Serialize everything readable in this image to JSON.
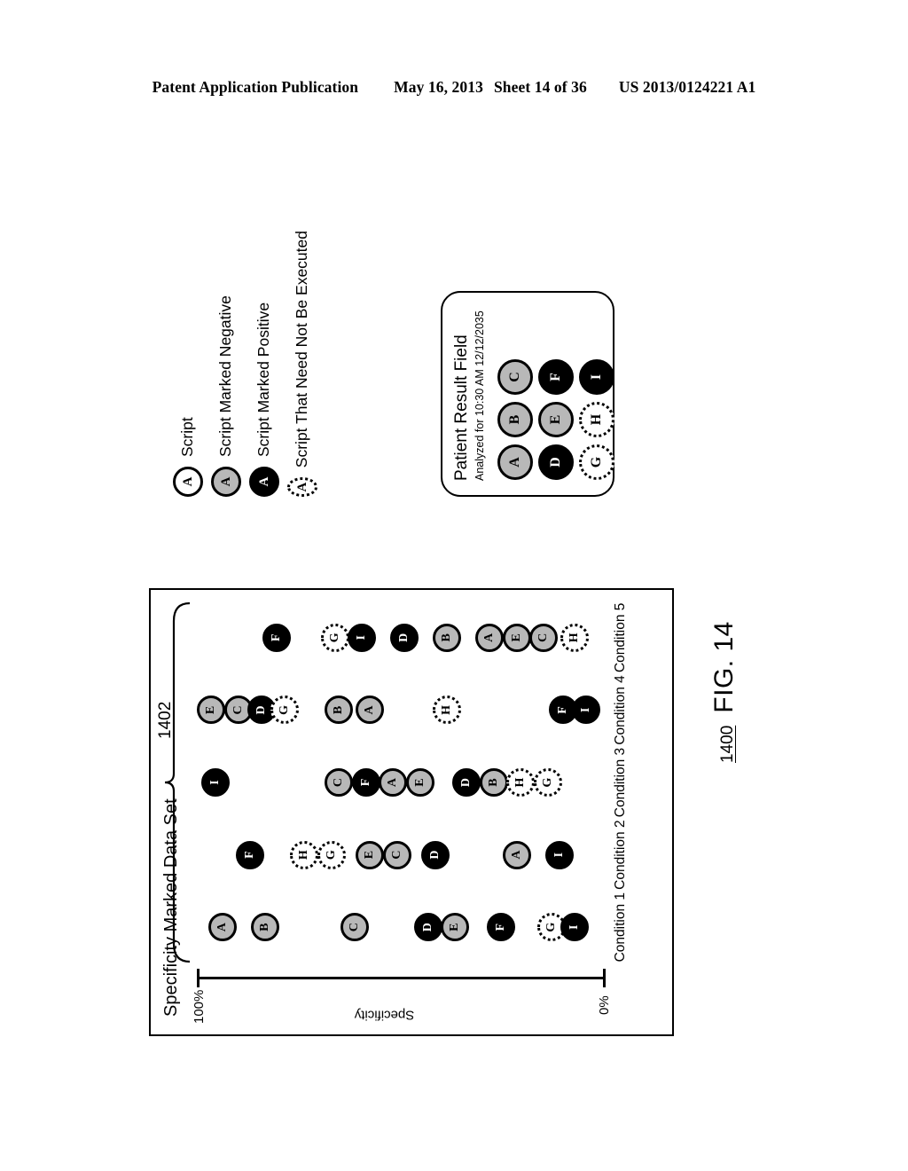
{
  "patent_header": {
    "publication": "Patent Application Publication",
    "date": "May 16, 2013",
    "sheet": "Sheet 14 of 36",
    "number": "US 2013/0124221 A1"
  },
  "legend": {
    "items": [
      {
        "marker": "A",
        "style": "plain",
        "label": "Script"
      },
      {
        "marker": "A",
        "style": "gray",
        "label": "Script Marked Negative"
      },
      {
        "marker": "A",
        "style": "black",
        "label": "Script Marked Positive"
      },
      {
        "marker": "A",
        "style": "dashed",
        "label": "Script That Need Not Be Executed"
      }
    ]
  },
  "patient_result_field": {
    "title": "Patient Result Field",
    "subtitle": "Analyzed for 10:30 AM 12/12/2035",
    "grid": [
      {
        "marker": "A",
        "style": "gray"
      },
      {
        "marker": "B",
        "style": "gray"
      },
      {
        "marker": "C",
        "style": "gray"
      },
      {
        "marker": "D",
        "style": "black"
      },
      {
        "marker": "E",
        "style": "gray"
      },
      {
        "marker": "F",
        "style": "black"
      },
      {
        "marker": "G",
        "style": "dashed"
      },
      {
        "marker": "H",
        "style": "dashed"
      },
      {
        "marker": "I",
        "style": "black"
      }
    ]
  },
  "figure": {
    "label": "FIG. 14",
    "number": "1400",
    "callout": "1402"
  },
  "chart_data": {
    "type": "scatter",
    "title": "Specificity Marked Data Set",
    "xlabel": "",
    "ylabel": "Specificity",
    "ylim": [
      0,
      100
    ],
    "ytick_labels": [
      "100%",
      "0%"
    ],
    "grid": false,
    "legend_position": "external-top-left",
    "categories": [
      "Condition 1",
      "Condition 2",
      "Condition 3",
      "Condition 4",
      "Condition 5"
    ],
    "callout_label": "1402",
    "callout_note": "Bracket spanning all conditions",
    "series": [
      {
        "name": "Condition 1",
        "points": [
          {
            "marker": "A",
            "style": "gray",
            "specificity": 96
          },
          {
            "marker": "B",
            "style": "gray",
            "specificity": 85
          },
          {
            "marker": "C",
            "style": "gray",
            "specificity": 62
          },
          {
            "marker": "D",
            "style": "black",
            "specificity": 43
          },
          {
            "marker": "E",
            "style": "gray",
            "specificity": 36
          },
          {
            "marker": "F",
            "style": "black",
            "specificity": 24
          },
          {
            "marker": "G",
            "style": "dashed",
            "specificity": 11
          },
          {
            "marker": "I",
            "style": "black",
            "specificity": 5
          }
        ]
      },
      {
        "name": "Condition 2",
        "points": [
          {
            "marker": "F",
            "style": "black",
            "specificity": 89
          },
          {
            "marker": "H",
            "style": "dashed",
            "specificity": 75
          },
          {
            "marker": "G",
            "style": "dashed",
            "specificity": 68
          },
          {
            "marker": "E",
            "style": "gray",
            "specificity": 58
          },
          {
            "marker": "C",
            "style": "gray",
            "specificity": 51
          },
          {
            "marker": "D",
            "style": "black",
            "specificity": 41
          },
          {
            "marker": "A",
            "style": "gray",
            "specificity": 20
          },
          {
            "marker": "I",
            "style": "black",
            "specificity": 9
          }
        ]
      },
      {
        "name": "Condition 3",
        "points": [
          {
            "marker": "I",
            "style": "black",
            "specificity": 98
          },
          {
            "marker": "C",
            "style": "gray",
            "specificity": 66
          },
          {
            "marker": "F",
            "style": "black",
            "specificity": 59
          },
          {
            "marker": "A",
            "style": "gray",
            "specificity": 52
          },
          {
            "marker": "E",
            "style": "gray",
            "specificity": 45
          },
          {
            "marker": "D",
            "style": "black",
            "specificity": 33
          },
          {
            "marker": "B",
            "style": "gray",
            "specificity": 26
          },
          {
            "marker": "H",
            "style": "dashed",
            "specificity": 19
          },
          {
            "marker": "G",
            "style": "dashed",
            "specificity": 12
          }
        ]
      },
      {
        "name": "Condition 4",
        "points": [
          {
            "marker": "E",
            "style": "gray",
            "specificity": 99
          },
          {
            "marker": "C",
            "style": "gray",
            "specificity": 92
          },
          {
            "marker": "D",
            "style": "black",
            "specificity": 86
          },
          {
            "marker": "G",
            "style": "dashed",
            "specificity": 80
          },
          {
            "marker": "B",
            "style": "gray",
            "specificity": 66
          },
          {
            "marker": "A",
            "style": "gray",
            "specificity": 58
          },
          {
            "marker": "H",
            "style": "dashed",
            "specificity": 38
          },
          {
            "marker": "F",
            "style": "black",
            "specificity": 8
          },
          {
            "marker": "I",
            "style": "black",
            "specificity": 2
          }
        ]
      },
      {
        "name": "Condition 5",
        "points": [
          {
            "marker": "F",
            "style": "black",
            "specificity": 82
          },
          {
            "marker": "G",
            "style": "dashed",
            "specificity": 67
          },
          {
            "marker": "I",
            "style": "black",
            "specificity": 60
          },
          {
            "marker": "D",
            "style": "black",
            "specificity": 49
          },
          {
            "marker": "B",
            "style": "gray",
            "specificity": 38
          },
          {
            "marker": "A",
            "style": "gray",
            "specificity": 27
          },
          {
            "marker": "E",
            "style": "gray",
            "specificity": 20
          },
          {
            "marker": "C",
            "style": "gray",
            "specificity": 13
          },
          {
            "marker": "H",
            "style": "dashed",
            "specificity": 5
          }
        ]
      }
    ]
  }
}
